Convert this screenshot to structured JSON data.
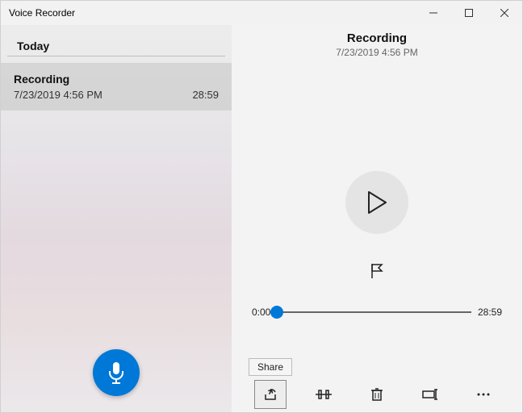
{
  "app": {
    "title": "Voice Recorder"
  },
  "sidebar": {
    "section": "Today",
    "items": [
      {
        "title": "Recording",
        "date": "7/23/2019 4:56 PM",
        "duration": "28:59"
      }
    ]
  },
  "main": {
    "title": "Recording",
    "date": "7/23/2019 4:56 PM",
    "timeline": {
      "start": "0:00",
      "end": "28:59"
    }
  },
  "tooltip": {
    "share": "Share"
  }
}
